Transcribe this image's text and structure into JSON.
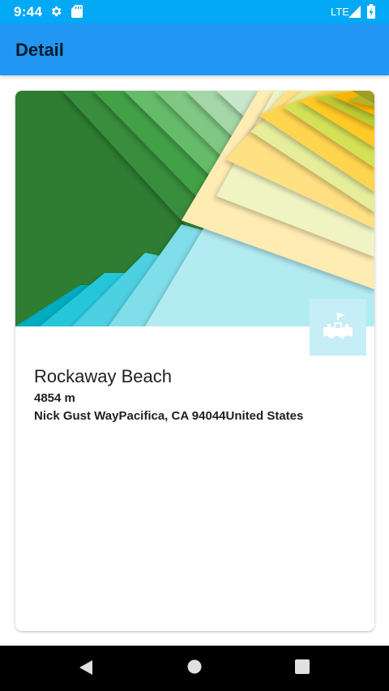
{
  "status_bar": {
    "time": "9:44",
    "network": "LTE",
    "icons": [
      "gear-icon",
      "sd-card-icon",
      "signal-icon",
      "battery-icon"
    ],
    "color": "#03A9F4"
  },
  "app_bar": {
    "title": "Detail",
    "color": "#2196F3"
  },
  "detail": {
    "name": "Rockaway Beach",
    "elevation": "4854 m",
    "address": "Nick Gust WayPacifica, CA 94044United States",
    "image_icon": "sandcastle-icon"
  },
  "nav_bar": {
    "icons": [
      "back-icon",
      "home-icon",
      "recents-icon"
    ]
  }
}
